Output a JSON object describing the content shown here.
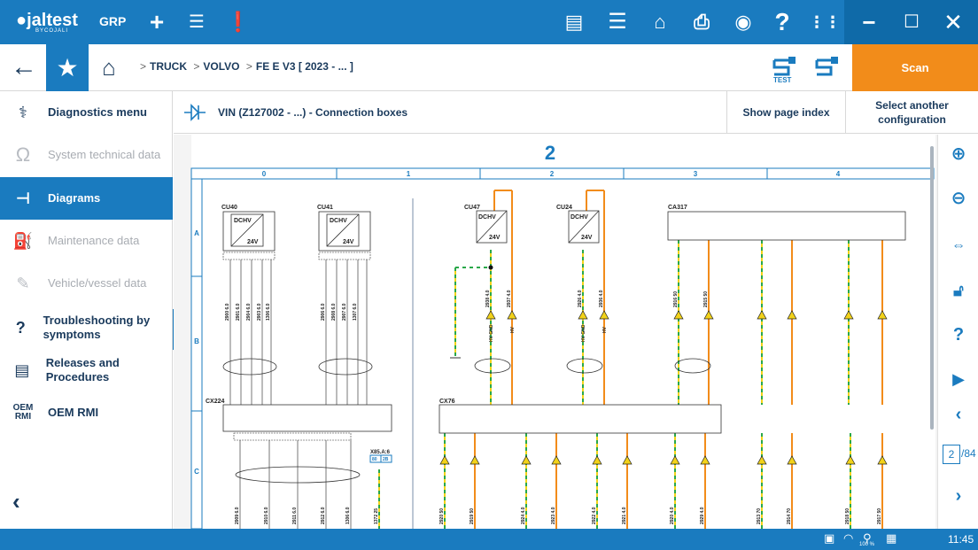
{
  "app": {
    "logo": "jaltest",
    "logo_sub": "BYCOJALI",
    "mode_label": "GRP",
    "accent": "#1a7bbf",
    "scan_color": "#f28c1a"
  },
  "toolbar": {
    "icons": [
      "plus-icon",
      "server-icon",
      "alert-icon",
      "document-icon",
      "list-icon",
      "engine-icon",
      "printer-icon",
      "camera-icon",
      "help-icon",
      "grid-icon"
    ],
    "test_label": "TEST"
  },
  "nav": {
    "breadcrumb": [
      "TRUCK",
      "VOLVO",
      "FE E V3 [ 2023 - ... ]"
    ],
    "scan_label": "Scan"
  },
  "sidebar": {
    "items": [
      {
        "label": "Diagnostics menu",
        "icon": "stethoscope-icon",
        "state": "normal"
      },
      {
        "label": "System technical data",
        "icon": "omega-icon",
        "state": "disabled"
      },
      {
        "label": "Diagrams",
        "icon": "diagram-icon",
        "state": "active"
      },
      {
        "label": "Maintenance data",
        "icon": "oilcan-icon",
        "state": "disabled"
      },
      {
        "label": "Vehicle/vessel data",
        "icon": "wrench-icon",
        "state": "disabled"
      },
      {
        "label": "Troubleshooting by symptoms",
        "icon": "troubleshoot-icon",
        "state": "normal"
      },
      {
        "label": "Releases and Procedures",
        "icon": "releases-icon",
        "state": "normal"
      },
      {
        "label": "OEM RMI",
        "icon": "oem-rmi-icon",
        "state": "normal"
      }
    ],
    "oem_badge_top": "OEM",
    "oem_badge_bottom": "RMI"
  },
  "content": {
    "title": "VIN (Z127002 - ...) - Connection boxes",
    "show_index_label": "Show page index",
    "select_config_label": "Select another configuration"
  },
  "diagram": {
    "page_number": "2",
    "columns": [
      "0",
      "1",
      "2",
      "3",
      "4"
    ],
    "rows": [
      "A",
      "B",
      "C"
    ],
    "components": [
      "CU40",
      "CU41",
      "CU47",
      "CU24",
      "CA317",
      "CX224",
      "CX76"
    ],
    "dchv_label": "DCHV",
    "voltage_label": "24V",
    "connector_label": "X85.A:6",
    "connector_pins": [
      "80",
      "2B"
    ],
    "wire_labels_a": [
      "2900 6.0",
      "2901 6.0",
      "2904 6.0",
      "2903 6.0",
      "1306 6.0",
      "2906 6.0",
      "2908 6.0",
      "2907 6.0",
      "1307 6.0",
      "2938 4.0",
      "2937 4.0",
      "2926 4.0",
      "2936 4.0",
      "2916 50",
      "2915 50"
    ],
    "hv_labels": [
      "HV GND",
      "HV"
    ],
    "wire_labels_c": [
      "2909 6.0",
      "2910 6.0",
      "2911 6.0",
      "2912 6.0",
      "1306 6.0",
      "1372 25",
      "2920 50",
      "2919 50",
      "2924 4.0",
      "2923 4.0",
      "2922 4.0",
      "2921 4.0",
      "2920 4.0",
      "2929 4.0",
      "2913 70",
      "2914 70",
      "2918 50",
      "2917 50"
    ]
  },
  "right_tools": {
    "icons": [
      "zoom-in-icon",
      "zoom-out-icon",
      "fit-width-icon",
      "unlock-icon",
      "help-search-icon",
      "video-icon",
      "prev-page-icon",
      "next-page-icon"
    ],
    "page_current": "2",
    "page_total": "/84"
  },
  "status_bar": {
    "zoom": "100 %",
    "time": "11:45"
  }
}
